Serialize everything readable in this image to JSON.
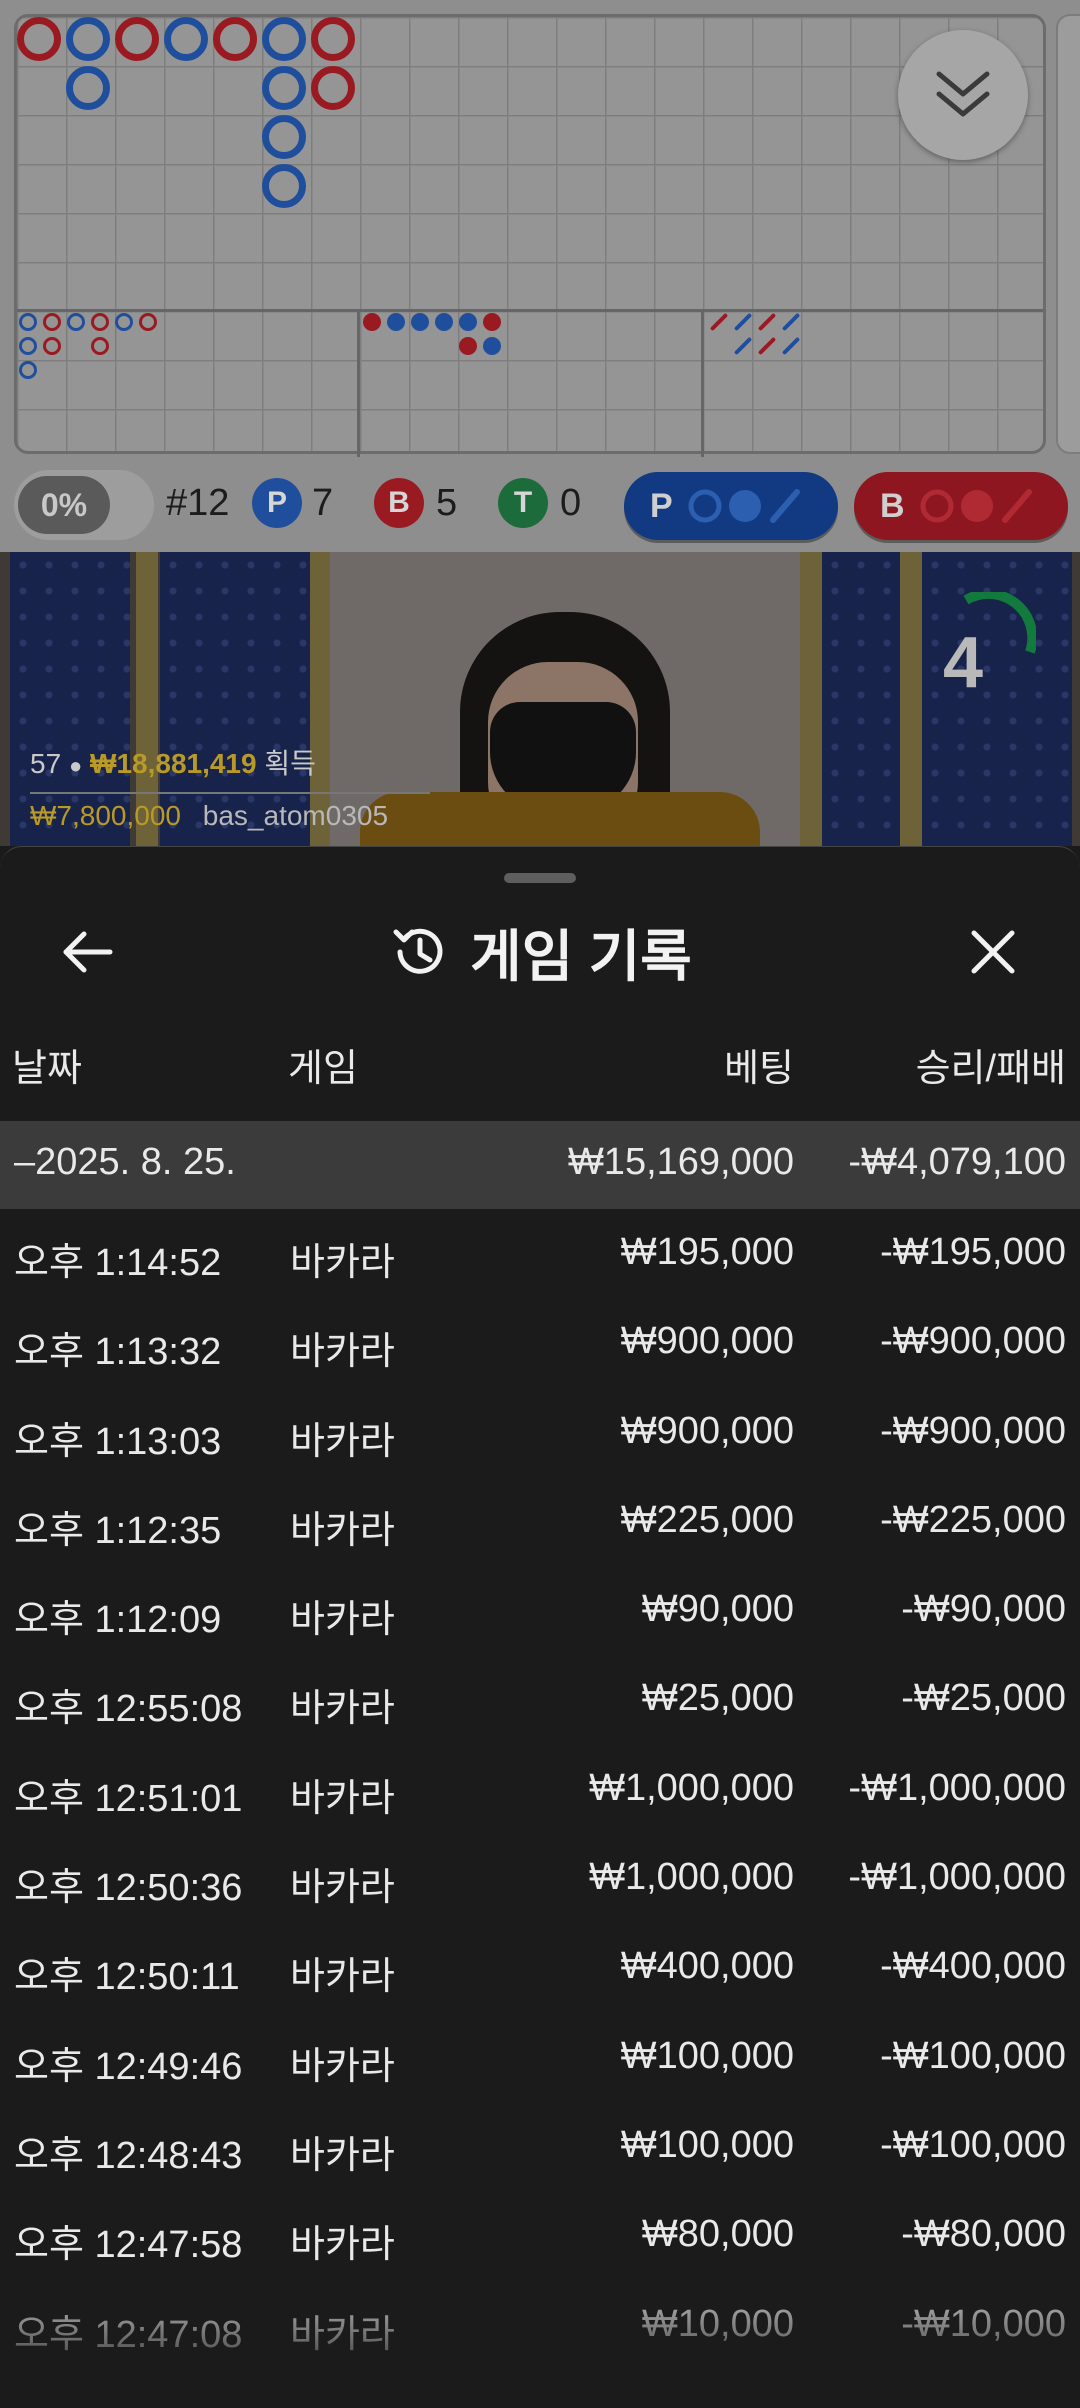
{
  "scoreboard": {
    "stats": {
      "percent": "0%",
      "round": "#12",
      "player_label": "P",
      "player_count": "7",
      "banker_label": "B",
      "banker_count": "5",
      "tie_label": "T",
      "tie_count": "0",
      "player_predict_label": "P",
      "banker_predict_label": "B"
    },
    "colors": {
      "player": "#1f4f9c",
      "banker": "#9a1a22",
      "tie": "#1c6b3a"
    }
  },
  "video": {
    "timer": "4",
    "players_count": "57",
    "total_won": "₩18,881,419",
    "won_label": "획득",
    "bet_amount": "₩7,800,000",
    "username": "bas_atom0305"
  },
  "sheet": {
    "title": "게임 기록",
    "headers": {
      "date": "날짜",
      "game": "게임",
      "bet": "베팅",
      "win_loss": "승리/패배"
    },
    "summary": {
      "date": "–2025. 8. 25.",
      "bet": "₩15,169,000",
      "win_loss": "-₩4,079,100"
    },
    "rows": [
      {
        "time": "오후 1:14:52",
        "game": "바카라",
        "bet": "₩195,000",
        "win_loss": "-₩195,000"
      },
      {
        "time": "오후 1:13:32",
        "game": "바카라",
        "bet": "₩900,000",
        "win_loss": "-₩900,000"
      },
      {
        "time": "오후 1:13:03",
        "game": "바카라",
        "bet": "₩900,000",
        "win_loss": "-₩900,000"
      },
      {
        "time": "오후 1:12:35",
        "game": "바카라",
        "bet": "₩225,000",
        "win_loss": "-₩225,000"
      },
      {
        "time": "오후 1:12:09",
        "game": "바카라",
        "bet": "₩90,000",
        "win_loss": "-₩90,000"
      },
      {
        "time": "오후 12:55:08",
        "game": "바카라",
        "bet": "₩25,000",
        "win_loss": "-₩25,000"
      },
      {
        "time": "오후 12:51:01",
        "game": "바카라",
        "bet": "₩1,000,000",
        "win_loss": "-₩1,000,000"
      },
      {
        "time": "오후 12:50:36",
        "game": "바카라",
        "bet": "₩1,000,000",
        "win_loss": "-₩1,000,000"
      },
      {
        "time": "오후 12:50:11",
        "game": "바카라",
        "bet": "₩400,000",
        "win_loss": "-₩400,000"
      },
      {
        "time": "오후 12:49:46",
        "game": "바카라",
        "bet": "₩100,000",
        "win_loss": "-₩100,000"
      },
      {
        "time": "오후 12:48:43",
        "game": "바카라",
        "bet": "₩100,000",
        "win_loss": "-₩100,000"
      },
      {
        "time": "오후 12:47:58",
        "game": "바카라",
        "bet": "₩80,000",
        "win_loss": "-₩80,000"
      },
      {
        "time": "오후 12:47:08",
        "game": "바카라",
        "bet": "₩10,000",
        "win_loss": "-₩10,000"
      }
    ]
  }
}
